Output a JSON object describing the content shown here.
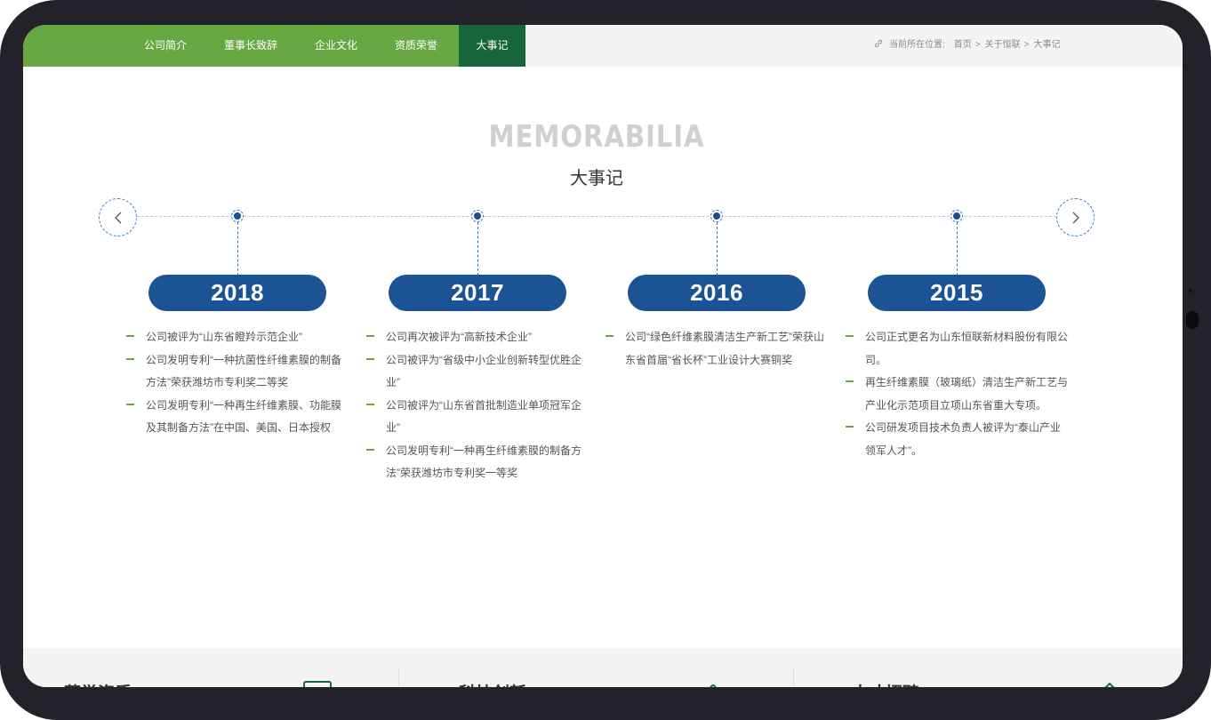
{
  "nav": {
    "items": [
      {
        "label": "公司简介",
        "active": false
      },
      {
        "label": "董事长致辞",
        "active": false
      },
      {
        "label": "企业文化",
        "active": false
      },
      {
        "label": "资质荣誉",
        "active": false
      },
      {
        "label": "大事记",
        "active": true
      }
    ],
    "accent_color": "#67a843",
    "active_color": "#17653a"
  },
  "breadcrumb": {
    "icon": "link-icon",
    "prefix": "当前所在位置:",
    "items": [
      "首页",
      "关于恒联",
      "大事记"
    ],
    "separator": ">"
  },
  "heading": {
    "en": "MEMORABILIA",
    "cn": "大事记"
  },
  "timeline": {
    "prev_icon": "chevron-left-icon",
    "next_icon": "chevron-right-icon",
    "pill_color": "#1c5394",
    "entries": [
      {
        "year": "2018",
        "events": [
          "公司被评为“山东省瞪羚示范企业”",
          "公司发明专利“一种抗菌性纤维素膜的制备方法”荣获潍坊市专利奖二等奖",
          "公司发明专利“一种再生纤维素膜、功能膜及其制备方法”在中国、美国、日本授权"
        ]
      },
      {
        "year": "2017",
        "events": [
          "公司再次被评为“高新技术企业”",
          "公司被评为“省级中小企业创新转型优胜企业”",
          "公司被评为“山东省首批制造业单项冠军企业”",
          "公司发明专利“一种再生纤维素膜的制备方法”荣获潍坊市专利奖一等奖"
        ]
      },
      {
        "year": "2016",
        "events": [
          "公司“绿色纤维素膜清洁生产新工艺”荣获山东省首届“省长杯”工业设计大赛铜奖"
        ]
      },
      {
        "year": "2015",
        "events": [
          "公司正式更名为山东恒联新材料股份有限公司。",
          "再生纤维素膜（玻璃纸）清洁生产新工艺与产业化示范项目立项山东省重大专项。",
          "公司研发项目技术负责人被评为“泰山产业领军人才”。"
        ]
      }
    ]
  },
  "bottom": {
    "items": [
      {
        "title": "荣誉资质",
        "icon": "certificate-icon"
      },
      {
        "title": "科技创新",
        "icon": "flask-icon"
      },
      {
        "title": "人才招聘",
        "icon": "person-icon"
      }
    ]
  }
}
